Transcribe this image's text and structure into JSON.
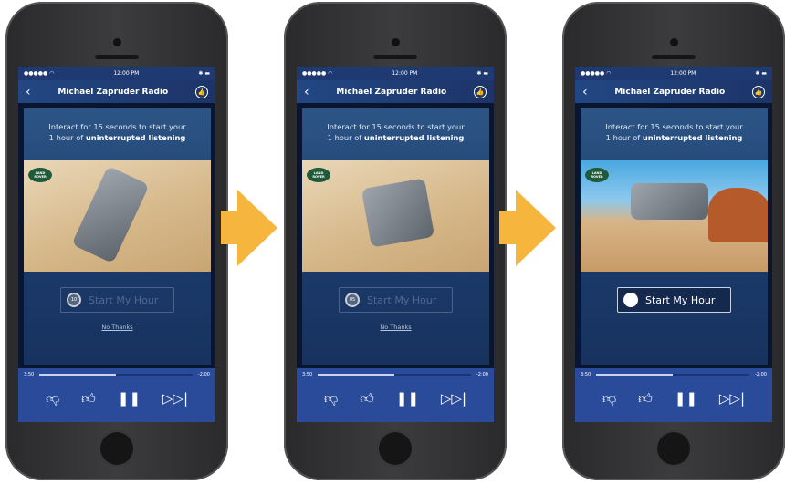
{
  "accent_colors": {
    "arrow": "#f6b63e",
    "player": "#2a4b9a",
    "nav": "#234783"
  },
  "status": {
    "time": "12:00 PM"
  },
  "nav": {
    "title": "Michael Zapruder Radio"
  },
  "message": {
    "line1": "Interact for 15 seconds to start your",
    "line2_prefix": "1 hour of ",
    "line2_bold": "uninterrupted listening"
  },
  "ad": {
    "brand_logo": "LAND ROVER"
  },
  "cta": {
    "label": "Start My Hour"
  },
  "no_thanks": "No Thanks",
  "player": {
    "elapsed": "3:50",
    "remaining": "-2:00",
    "progress": 0.5,
    "icons": [
      "thumbs-down-icon",
      "thumbs-up-icon",
      "pause-icon",
      "skip-icon"
    ]
  },
  "phones": [
    {
      "timer": "10",
      "cta_enabled": false,
      "scene": "car-top"
    },
    {
      "timer": "05",
      "cta_enabled": false,
      "scene": "car-rear"
    },
    {
      "timer": "",
      "cta_enabled": true,
      "scene": "car-hill"
    }
  ]
}
